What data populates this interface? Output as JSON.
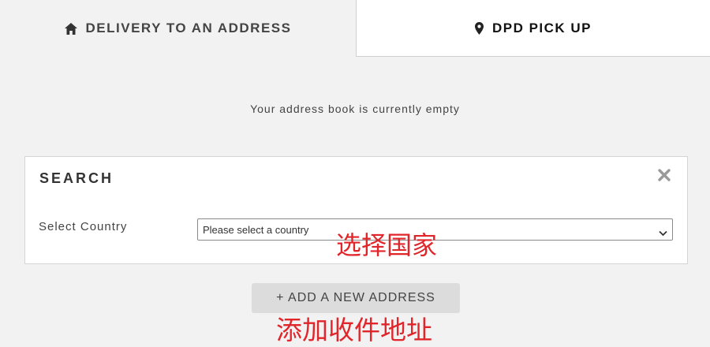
{
  "tabs": {
    "delivery": {
      "label": "DELIVERY TO AN ADDRESS",
      "icon": "home-icon"
    },
    "pickup": {
      "label": "DPD PICK UP",
      "icon": "map-pin-icon",
      "active": true
    }
  },
  "address_book": {
    "empty_message": "Your address book is currently empty"
  },
  "search": {
    "title": "SEARCH",
    "close_icon": "close-icon",
    "country_label": "Select Country",
    "country_select_value": "Please select a country"
  },
  "add_address": {
    "label": "+ ADD A NEW ADDRESS"
  },
  "annotations": {
    "select_country": "选择国家",
    "add_address": "添加收件地址",
    "color": "#e0262b"
  }
}
